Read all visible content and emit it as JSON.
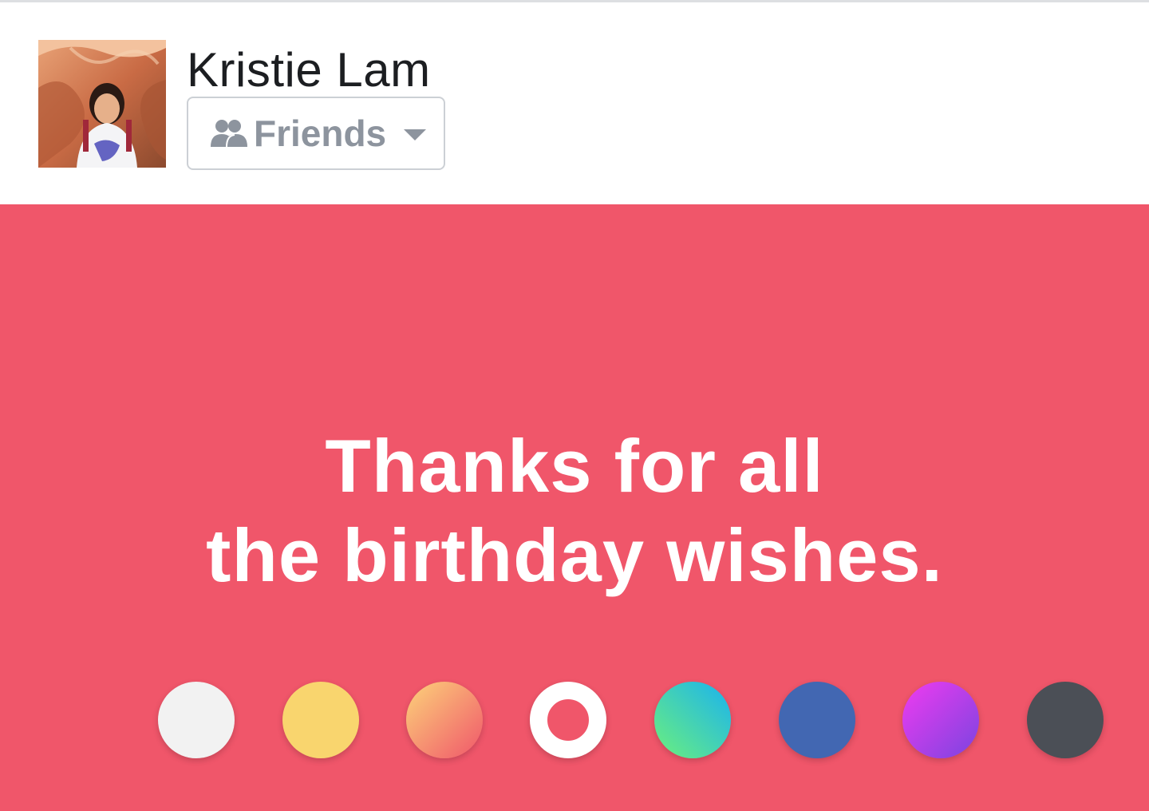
{
  "composer": {
    "user_name": "Kristie Lam",
    "avatar_alt": "Kristie Lam profile photo",
    "audience": {
      "label": "Friends",
      "icon": "friends-icon",
      "dropdown_icon": "caret-down-icon"
    }
  },
  "post": {
    "background_color": "#f0566a",
    "text_lines": [
      "Thanks for all",
      "the birthday wishes."
    ],
    "text_color": "#ffffff"
  },
  "background_options": [
    {
      "name": "white",
      "fill": "#f2f2f2",
      "selected": false
    },
    {
      "name": "yellow",
      "fill": "#f9d56e",
      "selected": false
    },
    {
      "name": "orange-gradient",
      "fill": "linear-gradient(135deg, #fcd37a 0%, #f0566a 100%)",
      "selected": false
    },
    {
      "name": "red",
      "fill": "#f0566a",
      "selected": true
    },
    {
      "name": "teal-gradient",
      "fill": "linear-gradient(45deg, #6cf07c 0%, #1ab2f0 100%)",
      "selected": false
    },
    {
      "name": "blue",
      "fill": "#4267b2",
      "selected": false
    },
    {
      "name": "purple-gradient",
      "fill": "linear-gradient(135deg, #f03bf0 0%, #7a44e0 100%)",
      "selected": false
    },
    {
      "name": "dark-gray",
      "fill": "#4b4f56",
      "selected": false
    }
  ]
}
